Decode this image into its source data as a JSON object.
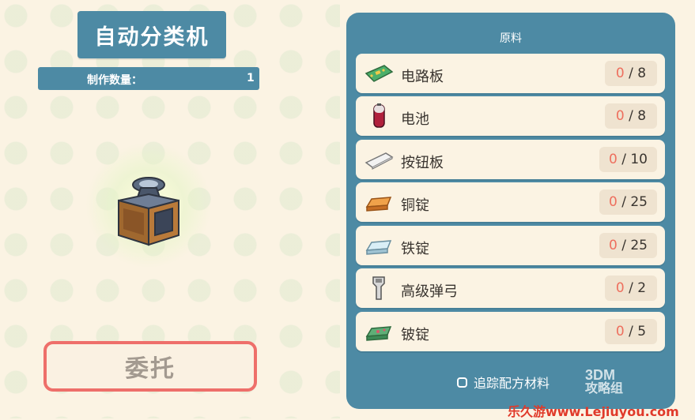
{
  "header": {
    "machine_title": "自动分类机",
    "quantity_label": "制作数量：",
    "quantity_value": "1"
  },
  "action": {
    "commission_label": "委托"
  },
  "materials_panel": {
    "title": "原料",
    "items": [
      {
        "name": "电路板",
        "have": "0",
        "sep": " / ",
        "need": "8",
        "icon": "circuit-board-icon"
      },
      {
        "name": "电池",
        "have": "0",
        "sep": " / ",
        "need": "8",
        "icon": "battery-icon"
      },
      {
        "name": "按钮板",
        "have": "0",
        "sep": " / ",
        "need": "10",
        "icon": "button-board-icon"
      },
      {
        "name": "铜锭",
        "have": "0",
        "sep": " / ",
        "need": "25",
        "icon": "copper-ingot-icon"
      },
      {
        "name": "铁锭",
        "have": "0",
        "sep": " / ",
        "need": "25",
        "icon": "iron-ingot-icon"
      },
      {
        "name": "高级弹弓",
        "have": "0",
        "sep": " / ",
        "need": "2",
        "icon": "slingshot-icon"
      },
      {
        "name": "铍锭",
        "have": "0",
        "sep": " / ",
        "need": "5",
        "icon": "beryllium-ingot-icon"
      }
    ],
    "track_label": "追踪配方材料"
  },
  "watermark": {
    "brand": "3DM",
    "brand_sub": "攻略组",
    "site": "乐久游www.Lejiuyou.com"
  },
  "colors": {
    "panel": "#4d8aa4",
    "background": "#fbf3e3",
    "button_border": "#ee6f6a",
    "have_count": "#ee6f5e"
  }
}
